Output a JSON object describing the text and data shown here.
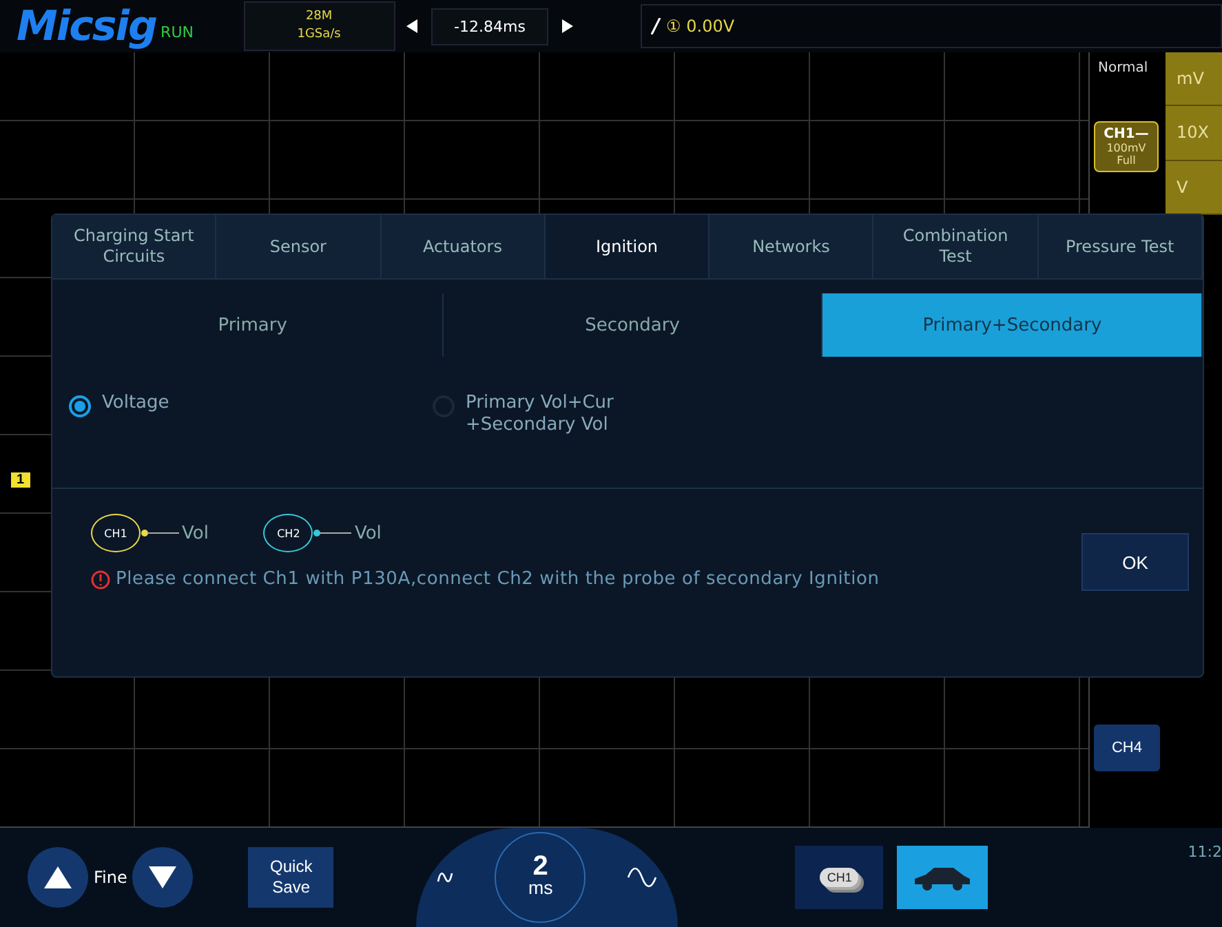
{
  "header": {
    "logo": "Micsig",
    "run_status": "RUN",
    "memory_depth": "28M",
    "sample_rate": "1GSa/s",
    "time_offset": "-12.84ms",
    "trigger_source": "①",
    "trigger_level": "0.00V"
  },
  "side_panel": {
    "trigger_mode": "Normal",
    "ch1": {
      "label": "CH1—",
      "scale": "100mV",
      "bandwidth": "Full"
    },
    "units": [
      "mV",
      "10X",
      "V"
    ],
    "ch4": "CH4",
    "clock": "11:2"
  },
  "channel_marker": "1",
  "dialog": {
    "tabs": [
      {
        "label": "Charging Start Circuits",
        "selected": false
      },
      {
        "label": "Sensor",
        "selected": false
      },
      {
        "label": "Actuators",
        "selected": false
      },
      {
        "label": "Ignition",
        "selected": true
      },
      {
        "label": "Networks",
        "selected": false
      },
      {
        "label": "Combination Test",
        "selected": false
      },
      {
        "label": "Pressure Test",
        "selected": false
      }
    ],
    "subtabs": [
      {
        "label": "Primary",
        "selected": false
      },
      {
        "label": "Secondary",
        "selected": false
      },
      {
        "label": "Primary+Secondary",
        "selected": true
      }
    ],
    "options": [
      {
        "label": "Voltage",
        "selected": true
      },
      {
        "label": "Primary Vol+Cur +Secondary Vol",
        "selected": false
      }
    ],
    "connections": [
      {
        "channel": "CH1",
        "signal": "Vol",
        "color": "#e8d84a"
      },
      {
        "channel": "CH2",
        "signal": "Vol",
        "color": "#38c8d8"
      }
    ],
    "message": "Please connect Ch1 with P130A,connect Ch2 with the probe of secondary Ignition",
    "ok": "OK"
  },
  "bottom_bar": {
    "fine": "Fine",
    "quick_save": "Quick Save",
    "timebase_value": "2",
    "timebase_unit": "ms",
    "channel_stack": "CH1"
  }
}
